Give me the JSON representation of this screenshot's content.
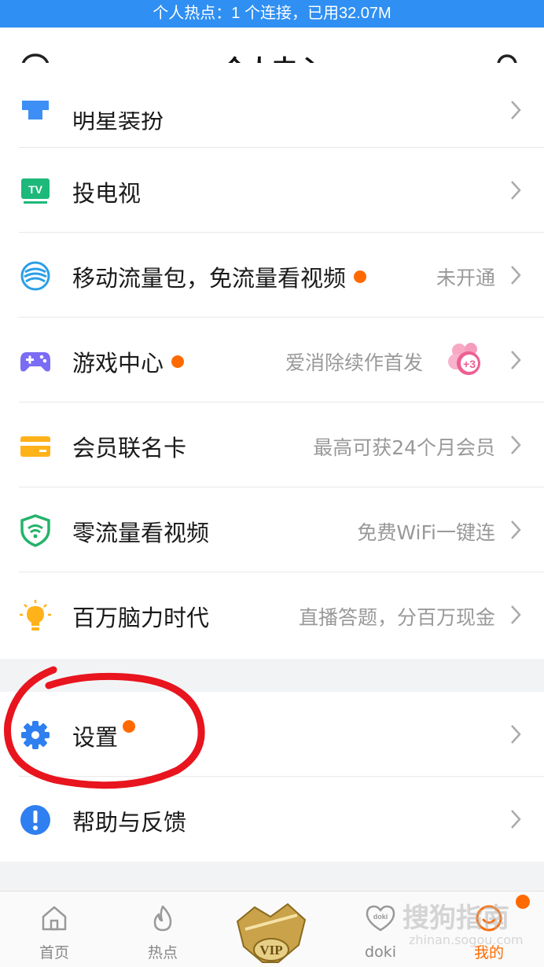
{
  "status_bar": {
    "hotspot_text": "个人热点：1 个连接，已用32.07M"
  },
  "header": {
    "title": "个人中心"
  },
  "menu": [
    {
      "label": "明星装扮",
      "value": "",
      "has_dot": false,
      "icon": "star-outfit-icon"
    },
    {
      "label": "投电视",
      "value": "",
      "has_dot": false,
      "icon": "tv-icon"
    },
    {
      "label": "移动流量包，免流量看视频",
      "value": "未开通",
      "has_dot": true,
      "icon": "china-mobile-icon"
    },
    {
      "label": "游戏中心",
      "value": "爱消除续作首发",
      "has_dot": true,
      "icon": "gamepad-icon"
    },
    {
      "label": "会员联名卡",
      "value": "最高可获24个月会员",
      "has_dot": false,
      "icon": "card-icon"
    },
    {
      "label": "零流量看视频",
      "value": "免费WiFi一键连",
      "has_dot": false,
      "icon": "wifi-shield-icon"
    },
    {
      "label": "百万脑力时代",
      "value": "直播答题，分百万现金",
      "has_dot": false,
      "icon": "lightbulb-icon"
    }
  ],
  "settings": [
    {
      "label": "设置",
      "has_dot": true,
      "icon": "gear-icon"
    },
    {
      "label": "帮助与反馈",
      "has_dot": false,
      "icon": "exclamation-icon"
    }
  ],
  "game_badge": {
    "text": "+3"
  },
  "tabbar": {
    "tabs": [
      {
        "label": "首页",
        "icon": "home-icon"
      },
      {
        "label": "热点",
        "icon": "flame-icon"
      },
      {
        "label": "doki",
        "icon": "heart-doki-icon",
        "icon_text": "doki"
      },
      {
        "label": "我的",
        "icon": "profile-icon"
      }
    ],
    "vip_label": "VIP"
  },
  "watermark": {
    "main": "搜狗指南",
    "sub": "zhinan.sogou.com"
  },
  "colors": {
    "brand_blue": "#2f8ff2",
    "accent_orange": "#ff6a00",
    "annotation_red": "#e8141e"
  }
}
